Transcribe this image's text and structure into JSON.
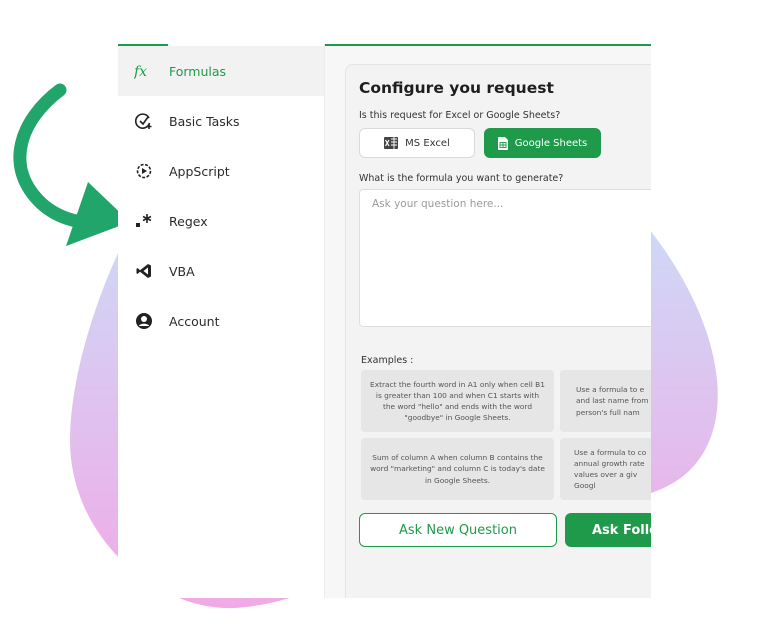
{
  "colors": {
    "accent": "#1f9a4a",
    "blob_top": "#cfd8f6",
    "blob_bottom": "#f1a9e6"
  },
  "sidebar": {
    "items": [
      {
        "label": "Formulas",
        "icon": "fx-icon",
        "active": true
      },
      {
        "label": "Basic Tasks",
        "icon": "check-plus-icon"
      },
      {
        "label": "AppScript",
        "icon": "play-gear-icon"
      },
      {
        "label": "Regex",
        "icon": "regex-icon"
      },
      {
        "label": "VBA",
        "icon": "vscode-icon"
      },
      {
        "label": "Account",
        "icon": "user-icon"
      }
    ]
  },
  "main": {
    "title": "Configure you request",
    "platform_question": "Is this request for Excel or Google Sheets?",
    "platform_options": {
      "excel": "MS Excel",
      "sheets": "Google Sheets",
      "selected": "Google Sheets"
    },
    "formula_question": "What is the formula you want to generate?",
    "question_placeholder": "Ask your question here...",
    "examples_label": "Examples :",
    "examples": [
      "Extract the fourth word in A1 only when cell B1 is greater than 100 and when C1 starts with the word \"hello\" and ends with the word \"goodbye\" in Google Sheets.",
      "Use a formula to e and last name from person's full nam",
      "Sum of column A when column B contains the word \"marketing\" and column C is today's date in Google Sheets.",
      "Use a formula to co annual growth rate values over a giv Googl"
    ],
    "buttons": {
      "ask_new": "Ask New Question",
      "ask_follow": "Ask Follow"
    }
  }
}
